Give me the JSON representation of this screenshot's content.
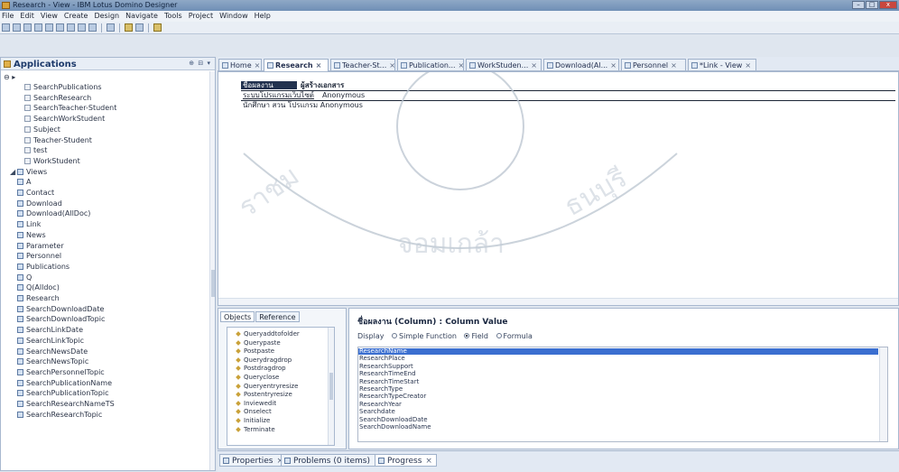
{
  "window": {
    "title": "Research - View - IBM Lotus Domino Designer",
    "controls": [
      "–",
      "□",
      "x"
    ]
  },
  "menu": [
    "File",
    "Edit",
    "View",
    "Create",
    "Design",
    "Navigate",
    "Tools",
    "Project",
    "Window",
    "Help"
  ],
  "applications": {
    "title": "Applications",
    "controls": "⊕ ⊟ ▾",
    "root_label": "⊖ ▸ ",
    "items": [
      {
        "label": "SearchPublications",
        "indent": 3,
        "icon": "design-element-icon"
      },
      {
        "label": "SearchResearch",
        "indent": 3,
        "icon": "design-element-icon"
      },
      {
        "label": "SearchTeacher-Student",
        "indent": 3,
        "icon": "design-element-icon"
      },
      {
        "label": "SearchWorkStudent",
        "indent": 3,
        "icon": "design-element-icon"
      },
      {
        "label": "Subject",
        "indent": 3,
        "icon": "design-element-icon"
      },
      {
        "label": "Teacher-Student",
        "indent": 3,
        "icon": "design-element-icon"
      },
      {
        "label": "test",
        "indent": 3,
        "icon": "design-element-icon"
      },
      {
        "label": "WorkStudent",
        "indent": 3,
        "icon": "design-element-icon"
      },
      {
        "label": "Views",
        "indent": 1,
        "icon": "views-folder-icon",
        "twisty": "◢"
      },
      {
        "label": "A",
        "indent": 2,
        "icon": "view-icon"
      },
      {
        "label": "Contact",
        "indent": 2,
        "icon": "view-icon"
      },
      {
        "label": "Download",
        "indent": 2,
        "icon": "view-icon"
      },
      {
        "label": "Download(AllDoc)",
        "indent": 2,
        "icon": "view-icon"
      },
      {
        "label": "Link",
        "indent": 2,
        "icon": "view-icon"
      },
      {
        "label": "News",
        "indent": 2,
        "icon": "view-icon"
      },
      {
        "label": "Parameter",
        "indent": 2,
        "icon": "view-icon"
      },
      {
        "label": "Personnel",
        "indent": 2,
        "icon": "view-icon"
      },
      {
        "label": "Publications",
        "indent": 2,
        "icon": "view-icon"
      },
      {
        "label": "Q",
        "indent": 2,
        "icon": "view-icon"
      },
      {
        "label": "Q(Alldoc)",
        "indent": 2,
        "icon": "view-icon"
      },
      {
        "label": "Research",
        "indent": 2,
        "icon": "view-icon"
      },
      {
        "label": "SearchDownloadDate",
        "indent": 2,
        "icon": "view-icon"
      },
      {
        "label": "SearchDownloadTopic",
        "indent": 2,
        "icon": "view-icon"
      },
      {
        "label": "SearchLinkDate",
        "indent": 2,
        "icon": "view-icon"
      },
      {
        "label": "SearchLinkTopic",
        "indent": 2,
        "icon": "view-icon"
      },
      {
        "label": "SearchNewsDate",
        "indent": 2,
        "icon": "view-icon"
      },
      {
        "label": "SearchNewsTopic",
        "indent": 2,
        "icon": "view-icon"
      },
      {
        "label": "SearchPersonnelTopic",
        "indent": 2,
        "icon": "view-icon"
      },
      {
        "label": "SearchPublicationName",
        "indent": 2,
        "icon": "view-icon"
      },
      {
        "label": "SearchPublicationTopic",
        "indent": 2,
        "icon": "view-icon"
      },
      {
        "label": "SearchResearchNameTS",
        "indent": 2,
        "icon": "view-icon"
      },
      {
        "label": "SearchResearchTopic",
        "indent": 2,
        "icon": "view-icon"
      }
    ]
  },
  "editor_tabs": [
    {
      "label": "Home",
      "active": false
    },
    {
      "label": "Research",
      "active": true
    },
    {
      "label": "Teacher-St...",
      "active": false
    },
    {
      "label": "Publication...",
      "active": false
    },
    {
      "label": "WorkStuden...",
      "active": false
    },
    {
      "label": "Download(Al...",
      "active": false
    },
    {
      "label": "Personnel",
      "active": false
    },
    {
      "label": "*Link - View",
      "active": false
    }
  ],
  "view_grid": {
    "header": [
      "ชื่อผลงาน",
      "ผู้สร้างเอกสาร"
    ],
    "rows": [
      [
        "ระบบโปรแกรมเว็บไซต์",
        "Anonymous"
      ],
      [
        "นักศึกษา สวน โปรแกรม Anonymous",
        ""
      ]
    ]
  },
  "objects_panel": {
    "tabs": [
      "Objects",
      "Reference"
    ],
    "items": [
      "Queryaddtofolder",
      "Querypaste",
      "Postpaste",
      "Querydragdrop",
      "Postdragdrop",
      "Queryclose",
      "Queryentryresize",
      "Postentryresize",
      "Inviewedit",
      "Onselect",
      "Initialize",
      "Terminate"
    ]
  },
  "code_panel": {
    "title": "ชื่อผลงาน (Column) : Column Value",
    "display_label": "Display",
    "options": [
      {
        "label": "Simple Function",
        "selected": false
      },
      {
        "label": "Field",
        "selected": true
      },
      {
        "label": "Formula",
        "selected": false
      }
    ],
    "fields": [
      "ResearchName",
      "ResearchPlace",
      "ResearchSupport",
      "ResearchTimeEnd",
      "ResearchTimeStart",
      "ResearchType",
      "ResearchTypeCreator",
      "ResearchYear",
      "Searchdate",
      "SearchDownloadDate",
      "SearchDownloadName"
    ]
  },
  "bottom_tabs": [
    {
      "label": "Properties",
      "active": false
    },
    {
      "label": "Problems (0 items)",
      "active": false
    },
    {
      "label": "Progress",
      "active": true
    }
  ],
  "colors": {
    "accent": "#3b6fd0",
    "header_dark": "#22324f",
    "watermark": "#bac4cf"
  }
}
